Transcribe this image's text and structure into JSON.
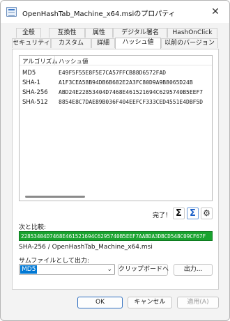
{
  "window": {
    "title": "OpenHashTab_Machine_x64.msiのプロパティ",
    "close_glyph": "✕"
  },
  "tabs_row1": [
    "全般",
    "互換性",
    "属性",
    "デジタル署名",
    "HashOnClick"
  ],
  "tabs_row2": [
    "セキュリティ",
    "カスタム",
    "詳細",
    "ハッシュ値",
    "以前のバージョン"
  ],
  "active_tab": "ハッシュ値",
  "hash_list": {
    "columns": [
      "アルゴリズム",
      "ハッシュ値"
    ],
    "rows": [
      {
        "algorithm": "MD5",
        "hash": "E49F5F55E8F5E7CA57FFCB88D6572FAD"
      },
      {
        "algorithm": "SHA-1",
        "hash": "A1F3CEA58B94DB6B682E2A3FC80D9A9B8065D24B"
      },
      {
        "algorithm": "SHA-256",
        "hash": "ABD24E22853404D7468E461521694C6295740B5EEF7"
      },
      {
        "algorithm": "SHA-512",
        "hash": "8854E8C7DAE89B036F404EEFCF333CED4551E4DBF5D"
      }
    ]
  },
  "status": {
    "done_text": "完了！",
    "sigma_glyph": "Σ",
    "sigma_check_glyph": "Σ",
    "gear_glyph": "⚙"
  },
  "compare": {
    "label": "次と比較:",
    "value": "22853404D7468E461521694C6295740B5EEF7AABDA3DBCD548C09CF67F",
    "match_text": "SHA-256 / OpenHashTab_Machine_x64.msi"
  },
  "export": {
    "label": "サムファイルとして出力:",
    "selected": "MD5",
    "clipboard_button": "クリップボードへ",
    "output_button": "出力..."
  },
  "dialog_buttons": {
    "ok": "OK",
    "cancel": "キャンセル",
    "apply": "適用(A)"
  },
  "colors": {
    "match_green": "#19a32f",
    "accent": "#0078d4"
  }
}
